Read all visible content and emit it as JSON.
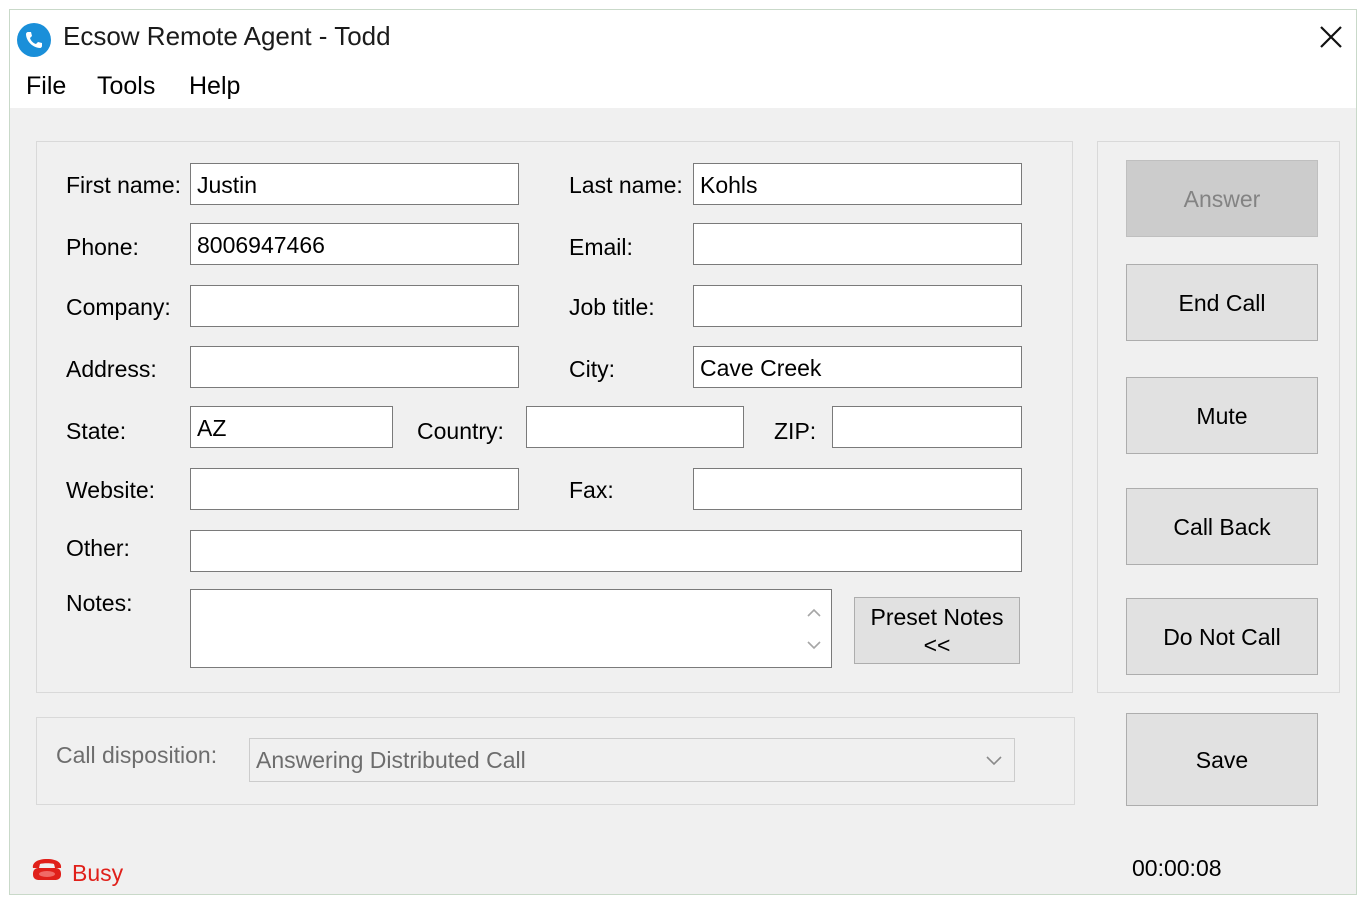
{
  "window": {
    "title": "Ecsow Remote Agent - Todd"
  },
  "menu": [
    "File",
    "Tools",
    "Help"
  ],
  "form": {
    "first_name": {
      "label": "First name:",
      "value": "Justin"
    },
    "last_name": {
      "label": "Last name:",
      "value": "Kohls"
    },
    "phone": {
      "label": "Phone:",
      "value": "8006947466"
    },
    "email": {
      "label": "Email:",
      "value": ""
    },
    "company": {
      "label": "Company:",
      "value": ""
    },
    "job_title": {
      "label": "Job title:",
      "value": ""
    },
    "address": {
      "label": "Address:",
      "value": ""
    },
    "city": {
      "label": "City:",
      "value": "Cave Creek"
    },
    "state": {
      "label": "State:",
      "value": "AZ"
    },
    "country": {
      "label": "Country:",
      "value": ""
    },
    "zip": {
      "label": "ZIP:",
      "value": ""
    },
    "website": {
      "label": "Website:",
      "value": ""
    },
    "fax": {
      "label": "Fax:",
      "value": ""
    },
    "other": {
      "label": "Other:",
      "value": ""
    },
    "notes": {
      "label": "Notes:",
      "value": ""
    },
    "preset_notes": {
      "line1": "Preset Notes",
      "line2": "<<"
    }
  },
  "call_buttons": {
    "answer": "Answer",
    "end_call": "End Call",
    "mute": "Mute",
    "call_back": "Call Back",
    "do_not_call": "Do Not Call",
    "save": "Save"
  },
  "disposition": {
    "label": "Call disposition:",
    "value": "Answering Distributed Call"
  },
  "status": {
    "text": "Busy",
    "color": "#e0201a",
    "icon": "busy-status-icon"
  },
  "timer": "00:00:08",
  "colors": {
    "app_icon": "#1a8fd9",
    "busy": "#e0201a"
  }
}
